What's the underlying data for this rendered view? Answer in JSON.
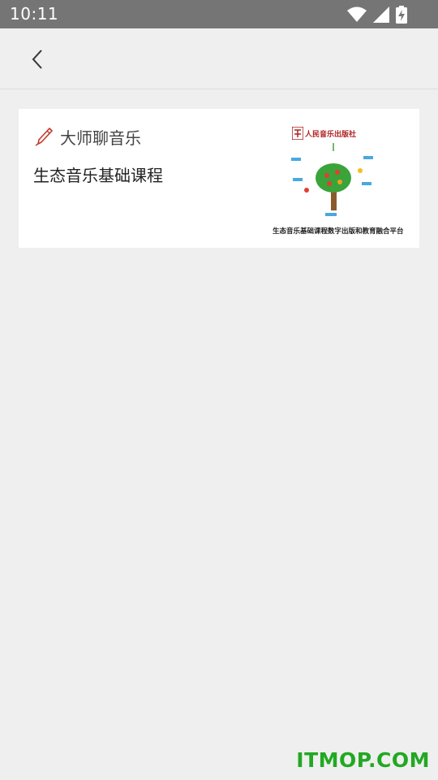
{
  "status_bar": {
    "time": "10:11"
  },
  "header": {
    "back_icon": "chevron-left-icon"
  },
  "card": {
    "category_icon": "pen-icon",
    "category": "大师聊音乐",
    "course_title": "生态音乐基础课程",
    "thumbnail": {
      "publisher": "人民音乐出版社",
      "caption": "生态音乐基础课程数字出版和教育融合平台"
    }
  },
  "watermark": "ITMOP.COM",
  "colors": {
    "status_bar": "#757575",
    "background": "#efefef",
    "card": "#ffffff",
    "watermark": "#22a822"
  }
}
